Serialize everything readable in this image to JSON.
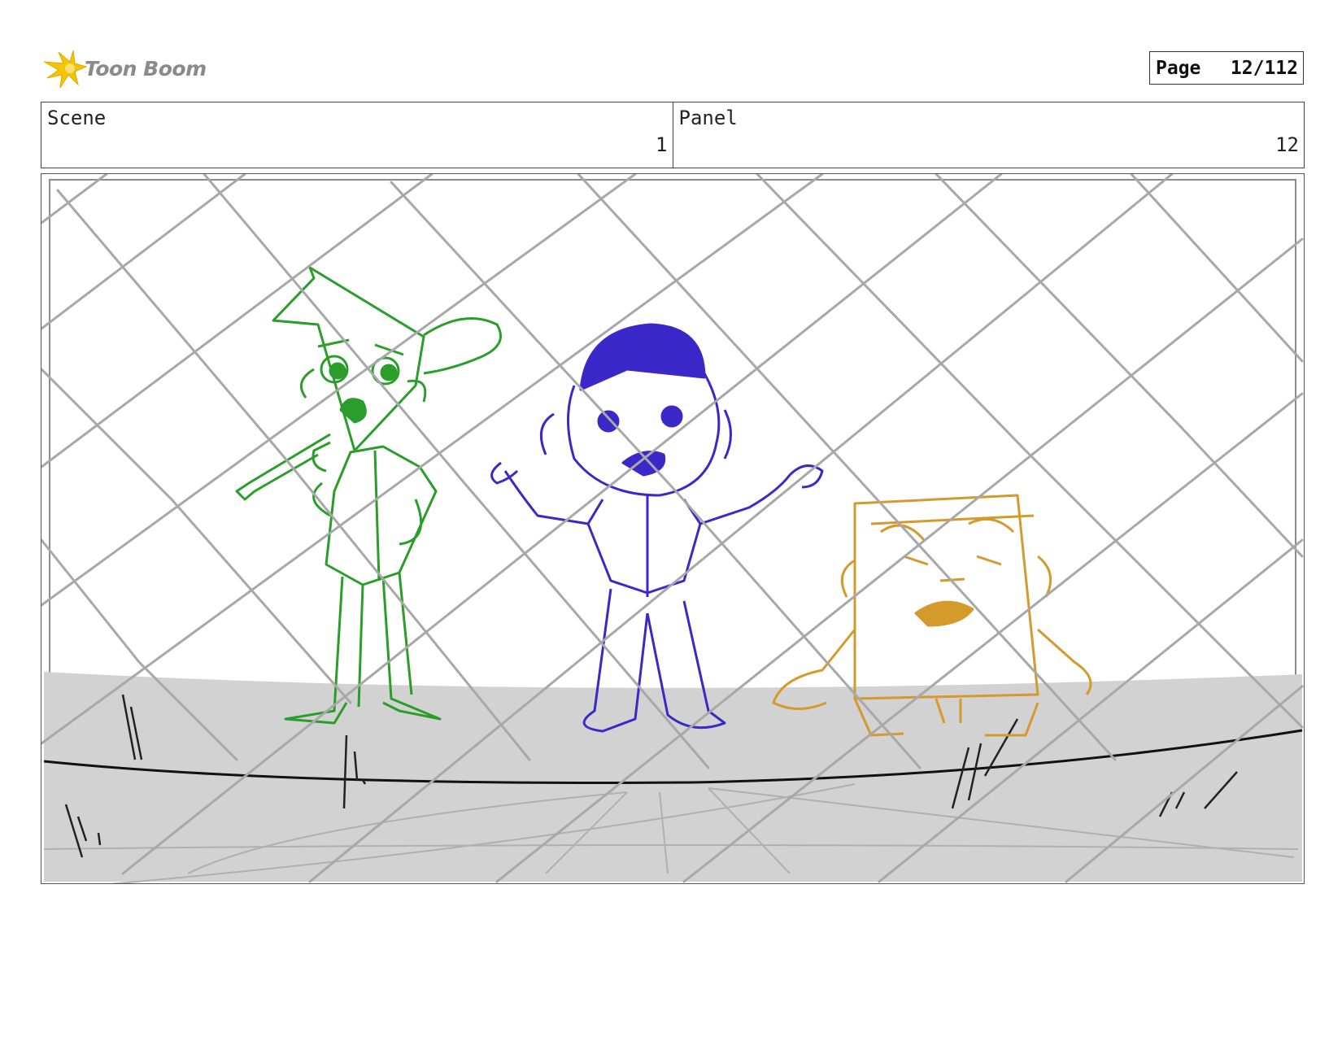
{
  "header": {
    "logo_text": "Toon Boom",
    "page_label": "Page",
    "page_value": "12/112"
  },
  "info": {
    "scene_label": "Scene",
    "scene_value": "1",
    "panel_label": "Panel",
    "panel_value": "12"
  },
  "colors": {
    "green_character": "#2a9d2a",
    "blue_character": "#3a28c8",
    "orange_character": "#d49a2c",
    "fence": "#a8a8a8",
    "ground": "#d2d2d2",
    "logo_star": "#f5c400"
  }
}
